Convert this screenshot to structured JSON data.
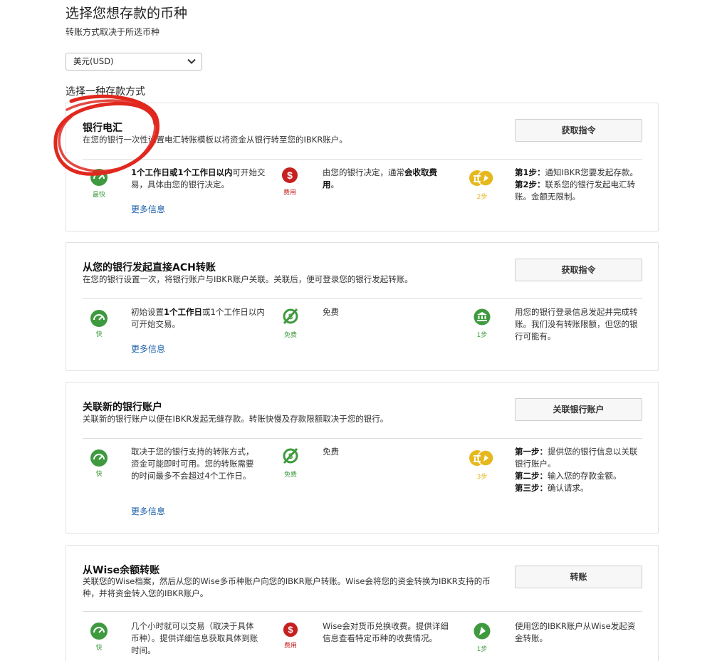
{
  "header": {
    "title": "选择您想存款的币种",
    "subtitle": "转账方式取决于所选币种"
  },
  "currency": {
    "selected": "美元(USD)"
  },
  "methods_label": "选择一种存款方式",
  "methods": [
    {
      "title": "银行电汇",
      "desc": "在您的银行一次性设置电汇转账模板以将资金从银行转至您的IBKR账户。",
      "button": "获取指令",
      "speed": {
        "icon": "speedometer-icon",
        "caption": "最快",
        "text_bold": "1个工作日或1个工作日以内",
        "text_rest": "可开始交易，具体由您的银行决定。",
        "link": "更多信息"
      },
      "fee": {
        "icon": "dollar-icon",
        "caption": "费用",
        "text_plain": "由您的银行决定，通常",
        "text_bold": "会收取费用",
        "text_tail": "。"
      },
      "steps": {
        "icon": "bank-hand-icon",
        "caption": "2步",
        "lines": [
          {
            "label": "第1步：",
            "text": "通知IBKR您要发起存款。"
          },
          {
            "label": "第2步：",
            "text": "联系您的银行发起电汇转账。金额无限制。"
          }
        ]
      }
    },
    {
      "title": "从您的银行发起直接ACH转账",
      "desc": "在您的银行设置一次，将银行账户与IBKR账户关联。关联后，便可登录您的银行发起转账。",
      "button": "获取指令",
      "speed": {
        "icon": "speedometer-icon",
        "caption": "快",
        "text_pre": "初始设置",
        "text_bold": "1个工作日",
        "text_rest": "或1个工作日以内可开始交易。",
        "link": "更多信息"
      },
      "fee": {
        "icon": "no-fee-icon",
        "caption": "免费",
        "text": "免费"
      },
      "steps": {
        "icon": "bank-icon",
        "caption": "1步",
        "text": "用您的银行登录信息发起并完成转账。我们没有转账限额，但您的银行可能有。"
      }
    },
    {
      "title": "关联新的银行账户",
      "desc": "关联新的银行账户以便在IBKR发起无缝存款。转账快慢及存款限额取决于您的银行。",
      "button": "关联银行账户",
      "speed": {
        "icon": "speedometer-icon",
        "caption": "快",
        "text": "取决于您的银行支持的转账方式，资金可能即时可用。您的转账需要的时间最多不会超过4个工作日。",
        "link": "更多信息"
      },
      "fee": {
        "icon": "no-fee-icon",
        "caption": "免费",
        "text": "免费"
      },
      "steps": {
        "icon": "bank-hand-icon",
        "caption": "3步",
        "lines": [
          {
            "label": "第一步：",
            "text": "提供您的银行信息以关联银行账户。"
          },
          {
            "label": "第二步：",
            "text": "输入您的存款金额。"
          },
          {
            "label": "第三步：",
            "text": "确认请求。"
          }
        ]
      }
    },
    {
      "title": "从Wise余额转账",
      "desc": "关联您的Wise档案，然后从您的Wise多币种账户向您的IBKR账户转账。Wise会将您的资金转换为IBKR支持的币种，并将资金转入您的IBKR账户。",
      "button": "转账",
      "speed": {
        "icon": "speedometer-icon",
        "caption": "快",
        "text": "几个小时就可以交易（取决于具体币种）。提供详细信息获取具体到账时间。"
      },
      "fee": {
        "icon": "dollar-icon",
        "caption": "费用",
        "text": "Wise会对货币兑换收费。提供详细信息查看特定币种的收费情况。"
      },
      "steps": {
        "icon": "hand-icon",
        "caption": "1步",
        "text": "使用您的IBKR账户从Wise发起资金转账。"
      }
    }
  ],
  "colors": {
    "green": "#3f9a3f",
    "red": "#c62020",
    "gold": "#e6b81e",
    "link": "#1a5fa8",
    "annotation": "#e0281e"
  }
}
